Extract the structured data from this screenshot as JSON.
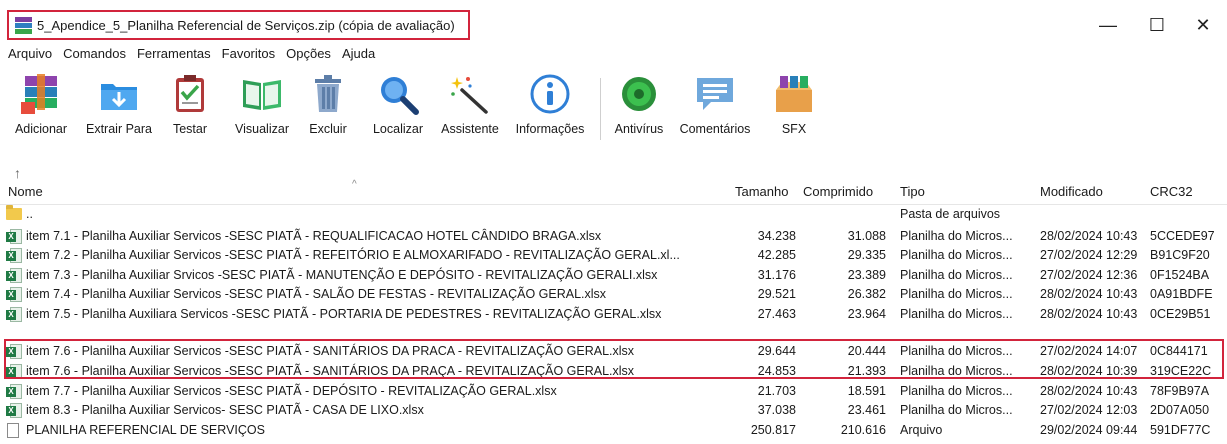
{
  "window": {
    "title": "5_Apendice_5_Planilha Referencial de Serviços.zip (cópia de avaliação)",
    "minimize": "—",
    "maximize": "☐",
    "close": "✕"
  },
  "menu": [
    "Arquivo",
    "Comandos",
    "Ferramentas",
    "Favoritos",
    "Opções",
    "Ajuda"
  ],
  "toolbar": [
    {
      "label": "Adicionar",
      "icon": "add-archive-icon"
    },
    {
      "label": "Extrair Para",
      "icon": "extract-folder-icon"
    },
    {
      "label": "Testar",
      "icon": "test-checklist-icon"
    },
    {
      "label": "Visualizar",
      "icon": "view-book-icon"
    },
    {
      "label": "Excluir",
      "icon": "trash-bin-icon"
    },
    {
      "label": "Localizar",
      "icon": "magnifier-icon"
    },
    {
      "label": "Assistente",
      "icon": "wizard-wand-icon"
    },
    {
      "label": "Informações",
      "icon": "info-icon"
    },
    {
      "label": "Antivírus",
      "icon": "antivirus-icon"
    },
    {
      "label": "Comentários",
      "icon": "comments-icon"
    },
    {
      "label": "SFX",
      "icon": "sfx-archive-icon"
    }
  ],
  "up_button": "↑",
  "columns": {
    "name": "Nome",
    "size": "Tamanho",
    "packed": "Comprimido",
    "type": "Tipo",
    "modified": "Modificado",
    "crc": "CRC32"
  },
  "rows": [
    {
      "icon": "folder-icon",
      "name": "..",
      "size": "",
      "packed": "",
      "type": "Pasta de arquivos",
      "modified": "",
      "crc": ""
    },
    {
      "icon": "excel-file-icon",
      "name": "item 7.1 - Planilha Auxiliar Servicos -SESC PIATÃ - REQUALIFICACAO HOTEL CÂNDIDO BRAGA.xlsx",
      "size": "34.238",
      "packed": "31.088",
      "type": "Planilha do Micros...",
      "modified": "28/02/2024 10:43",
      "crc": "5CCEDE97"
    },
    {
      "icon": "excel-file-icon",
      "name": "item 7.2 - Planilha Auxiliar Servicos -SESC PIATÃ - REFEITÓRIO E ALMOXARIFADO - REVITALIZAÇÃO GERAL.xl...",
      "size": "42.285",
      "packed": "29.335",
      "type": "Planilha do Micros...",
      "modified": "27/02/2024 12:29",
      "crc": "B91C9F20"
    },
    {
      "icon": "excel-file-icon",
      "name": "item 7.3 - Planilha Auxiliar Srvicos -SESC PIATÃ - MANUTENÇÃO E DEPÓSITO - REVITALIZAÇÃO GERALI.xlsx",
      "size": "31.176",
      "packed": "23.389",
      "type": "Planilha do Micros...",
      "modified": "27/02/2024 12:36",
      "crc": "0F1524BA"
    },
    {
      "icon": "excel-file-icon",
      "name": "item 7.4 - Planilha Auxiliar Servicos -SESC PIATÃ - SALÃO DE FESTAS - REVITALIZAÇÃO GERAL.xlsx",
      "size": "29.521",
      "packed": "26.382",
      "type": "Planilha do Micros...",
      "modified": "28/02/2024 10:43",
      "crc": "0A91BDFE"
    },
    {
      "icon": "excel-file-icon",
      "name": "item 7.5 - Planilha Auxiliara Servicos -SESC PIATÃ - PORTARIA DE PEDESTRES - REVITALIZAÇÃO GERAL.xlsx",
      "size": "27.463",
      "packed": "23.964",
      "type": "Planilha do Micros...",
      "modified": "28/02/2024 10:43",
      "crc": "0CE29B51"
    },
    {
      "icon": "excel-file-icon",
      "name": "item 7.6 - Planilha Auxiliar Servicos -SESC PIATÃ - SANITÁRIOS DA PRACA - REVITALIZAÇÃO GERAL.xlsx",
      "size": "29.644",
      "packed": "20.444",
      "type": "Planilha do Micros...",
      "modified": "27/02/2024 14:07",
      "crc": "0C844171"
    },
    {
      "icon": "excel-file-icon",
      "name": "item 7.6 - Planilha Auxiliar Servicos -SESC PIATÃ - SANITÁRIOS DA PRAÇA - REVITALIZAÇÃO GERAL.xlsx",
      "size": "24.853",
      "packed": "21.393",
      "type": "Planilha do Micros...",
      "modified": "28/02/2024 10:39",
      "crc": "319CE22C"
    },
    {
      "icon": "excel-file-icon",
      "name": "item 7.7 - Planilha Auxiliar Servicos -SESC PIATÃ - DEPÓSITO - REVITALIZAÇÃO GERAL.xlsx",
      "size": "21.703",
      "packed": "18.591",
      "type": "Planilha do Micros...",
      "modified": "28/02/2024 10:43",
      "crc": "78F9B97A"
    },
    {
      "icon": "excel-file-icon",
      "name": "item 8.3 - Planilha Auxiliar Servicos- SESC PIATÃ - CASA DE LIXO.xlsx",
      "size": "37.038",
      "packed": "23.461",
      "type": "Planilha do Micros...",
      "modified": "27/02/2024 12:03",
      "crc": "2D07A050"
    },
    {
      "icon": "generic-file-icon",
      "name": "PLANILHA REFERENCIAL DE SERVIÇOS",
      "size": "250.817",
      "packed": "210.616",
      "type": "Arquivo",
      "modified": "29/02/2024 09:44",
      "crc": "591DF77C"
    }
  ]
}
